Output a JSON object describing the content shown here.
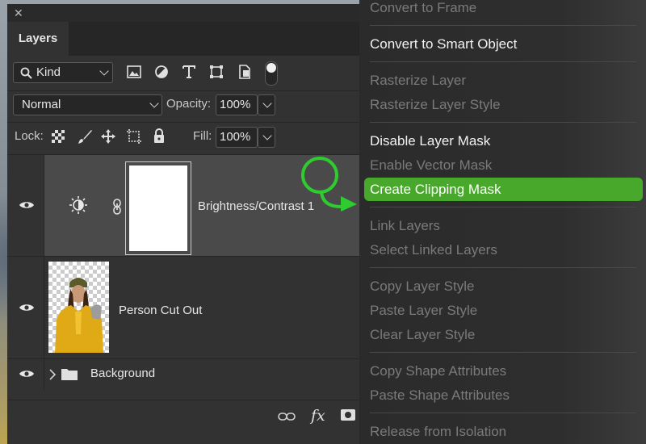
{
  "panel": {
    "tab_label": "Layers",
    "filter": {
      "label": "Kind"
    },
    "blend_mode": "Normal",
    "opacity_label": "Opacity:",
    "opacity_value": "100%",
    "lock_label": "Lock:",
    "fill_label": "Fill:",
    "fill_value": "100%",
    "layers": [
      {
        "name": "Brightness/Contrast 1",
        "selected": true
      },
      {
        "name": "Person Cut Out",
        "selected": false
      },
      {
        "name": "Background",
        "selected": false
      }
    ],
    "footer_fx": "fx"
  },
  "menu": {
    "items": [
      {
        "label": "Convert to Frame",
        "enabled": false
      },
      {
        "label": "Convert to Smart Object",
        "enabled": true
      },
      {
        "label": "Rasterize Layer",
        "enabled": false
      },
      {
        "label": "Rasterize Layer Style",
        "enabled": false
      },
      {
        "label": "Disable Layer Mask",
        "enabled": true
      },
      {
        "label": "Enable Vector Mask",
        "enabled": false
      },
      {
        "label": "Create Clipping Mask",
        "enabled": true,
        "highlighted": true
      },
      {
        "label": "Link Layers",
        "enabled": false
      },
      {
        "label": "Select Linked Layers",
        "enabled": false
      },
      {
        "label": "Copy Layer Style",
        "enabled": false
      },
      {
        "label": "Paste Layer Style",
        "enabled": false
      },
      {
        "label": "Clear Layer Style",
        "enabled": false
      },
      {
        "label": "Copy Shape Attributes",
        "enabled": false
      },
      {
        "label": "Paste Shape Attributes",
        "enabled": false
      },
      {
        "label": "Release from Isolation",
        "enabled": false
      }
    ]
  },
  "colors": {
    "highlight": "#48a82b",
    "annotation": "#2ecc2e",
    "panel": "#323232"
  }
}
